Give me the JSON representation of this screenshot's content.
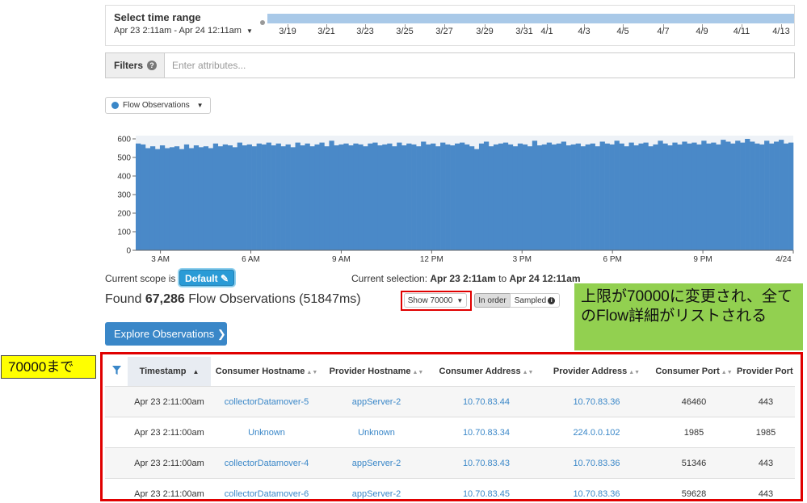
{
  "time_range": {
    "title": "Select time range",
    "range": "Apr 23 2:11am - Apr 24 12:11am",
    "ticks": [
      "3/19",
      "3/21",
      "3/23",
      "3/25",
      "3/27",
      "3/29",
      "3/31",
      "4/1",
      "4/3",
      "4/5",
      "4/7",
      "4/9",
      "4/11",
      "4/13"
    ]
  },
  "filters": {
    "label": "Filters",
    "help": "?",
    "placeholder": "Enter attributes..."
  },
  "dataset_dropdown": {
    "label": "Flow Observations",
    "color": "#3a87c8"
  },
  "chart_data": {
    "type": "bar",
    "color": "#4a89c8",
    "ylim": [
      0,
      600
    ],
    "y_ticks": [
      "0",
      "100",
      "200",
      "300",
      "400",
      "500",
      "600"
    ],
    "x_ticks": [
      "3 AM",
      "6 AM",
      "9 AM",
      "12 PM",
      "3 PM",
      "6 PM",
      "9 PM",
      "4/24"
    ],
    "x_tick_positions_hours": [
      3,
      6,
      9,
      12,
      15,
      18,
      21,
      24
    ],
    "x_start_hour": 2.18,
    "x_end_hour": 24,
    "values": [
      575,
      570,
      550,
      560,
      545,
      565,
      550,
      555,
      560,
      545,
      570,
      550,
      565,
      555,
      560,
      550,
      575,
      560,
      570,
      565,
      555,
      580,
      565,
      570,
      560,
      575,
      570,
      580,
      565,
      575,
      560,
      570,
      555,
      580,
      565,
      575,
      560,
      570,
      580,
      560,
      590,
      565,
      570,
      575,
      565,
      575,
      570,
      560,
      575,
      580,
      565,
      570,
      575,
      560,
      580,
      565,
      575,
      570,
      560,
      585,
      570,
      575,
      560,
      580,
      570,
      565,
      575,
      580,
      570,
      560,
      545,
      575,
      585,
      560,
      570,
      575,
      580,
      570,
      560,
      575,
      570,
      560,
      590,
      565,
      570,
      580,
      570,
      575,
      585,
      565,
      570,
      575,
      560,
      570,
      575,
      560,
      585,
      575,
      570,
      590,
      575,
      560,
      580,
      565,
      575,
      580,
      560,
      570,
      590,
      575,
      565,
      580,
      570,
      585,
      575,
      580,
      570,
      590,
      575,
      580,
      570,
      595,
      585,
      575,
      590,
      580,
      600,
      585,
      575,
      570,
      590,
      575,
      585,
      595,
      575,
      580
    ]
  },
  "scope": {
    "label": "Current scope is",
    "button": "Default ✎"
  },
  "selection": {
    "prefix": "Current selection:",
    "from": "Apr 23 2:11am",
    "to_word": "to",
    "to": "Apr 24 12:11am"
  },
  "found": {
    "prefix": "Found",
    "count": "67,286",
    "suffix": "Flow Observations (51847ms)"
  },
  "show_dropdown": "Show 70000",
  "order_toggle": {
    "in_order": "In order",
    "sampled": "Sampled",
    "info": "i"
  },
  "explore_button": "Explore Observations ❯",
  "annotations": {
    "green": "上限が70000に変更され、全てのFlow詳細がリストされる",
    "yellow": "70000まで"
  },
  "table": {
    "columns": [
      "Timestamp",
      "Consumer Hostname",
      "Provider Hostname",
      "Consumer Address",
      "Provider Address",
      "Consumer Port",
      "Provider Port"
    ],
    "rows": [
      [
        "Apr 23 2:11:00am",
        "collectorDatamover-5",
        "appServer-2",
        "10.70.83.44",
        "10.70.83.36",
        "46460",
        "443"
      ],
      [
        "Apr 23 2:11:00am",
        "Unknown",
        "Unknown",
        "10.70.83.34",
        "224.0.0.102",
        "1985",
        "1985"
      ],
      [
        "Apr 23 2:11:00am",
        "collectorDatamover-4",
        "appServer-2",
        "10.70.83.43",
        "10.70.83.36",
        "51346",
        "443"
      ],
      [
        "Apr 23 2:11:00am",
        "collectorDatamover-6",
        "appServer-2",
        "10.70.83.45",
        "10.70.83.36",
        "59628",
        "443"
      ]
    ]
  }
}
